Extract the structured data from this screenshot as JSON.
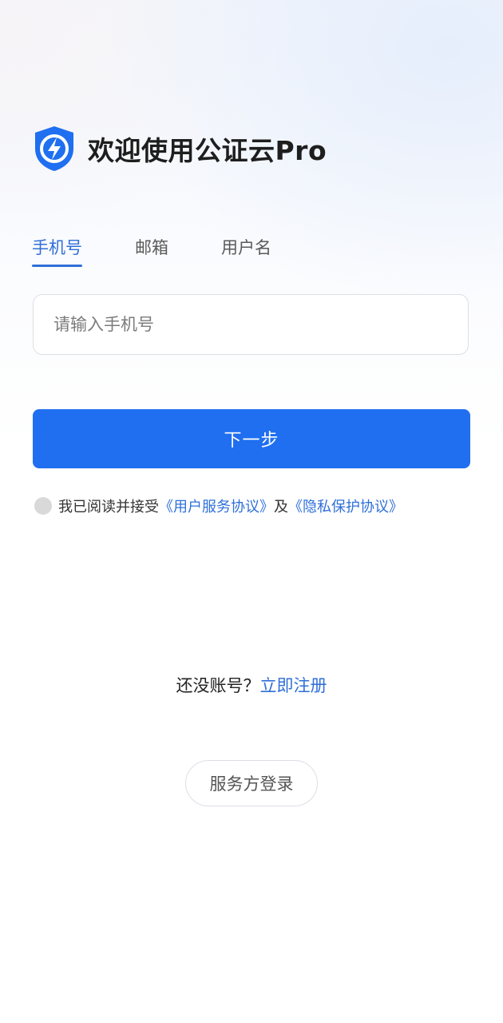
{
  "header": {
    "title": "欢迎使用公证云Pro",
    "logo_icon": "shield-lightning-icon",
    "brand_color": "#1f6ff0"
  },
  "tabs": [
    {
      "label": "手机号",
      "active": true
    },
    {
      "label": "邮箱",
      "active": false
    },
    {
      "label": "用户名",
      "active": false
    }
  ],
  "phone_input": {
    "placeholder": "请输入手机号",
    "value": ""
  },
  "next_button": {
    "label": "下一步"
  },
  "agreement": {
    "checked": false,
    "prefix": "我已阅读并接受",
    "user_agreement_link": "《用户服务协议》",
    "joiner": "及",
    "privacy_link": "《隐私保护协议》"
  },
  "register": {
    "prompt": "还没账号？",
    "link": "立即注册"
  },
  "provider_login": {
    "label": "服务方登录"
  },
  "colors": {
    "accent": "#2f6fd8",
    "button": "#1f6ff0",
    "radio_unchecked": "#d9d9d9"
  }
}
